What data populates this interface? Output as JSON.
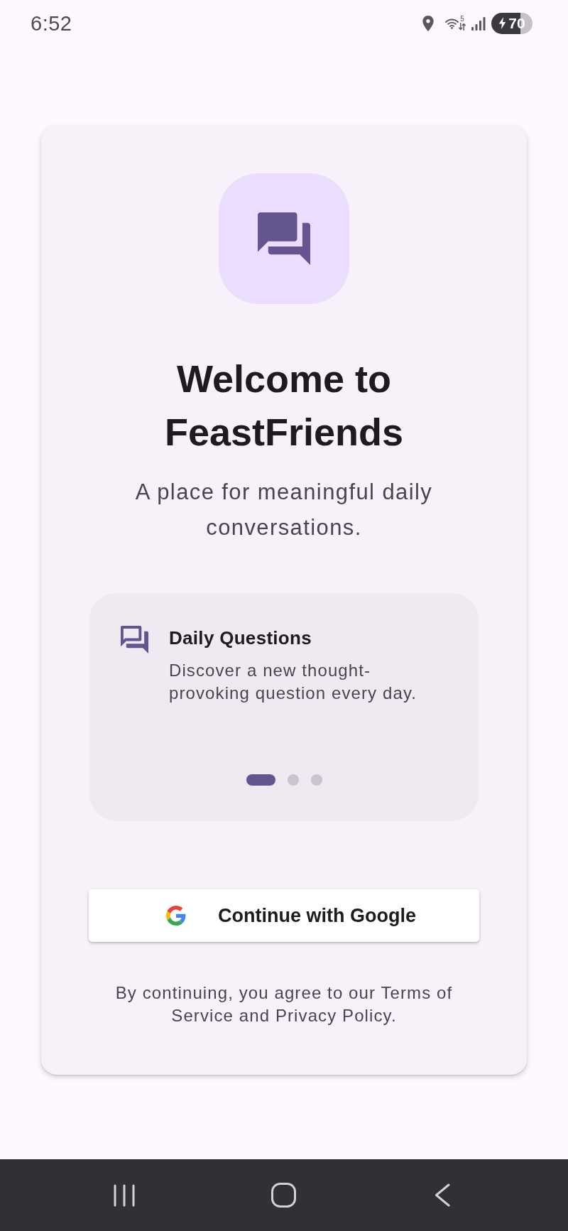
{
  "status_bar": {
    "time": "6:52",
    "wifi_band": "5",
    "battery": "70"
  },
  "welcome": {
    "title": "Welcome to FeastFriends",
    "subtitle": "A place for meaningful daily conversations.",
    "carousel": {
      "title": "Daily Questions",
      "description": "Discover a new thought-provoking question every day.",
      "page_dots": [
        {
          "selected": true
        },
        {
          "selected": false
        },
        {
          "selected": false
        }
      ]
    },
    "google_button": {
      "label": "Continue with Google"
    },
    "terms": "By continuing, you agree to our Terms of Service and Privacy Policy."
  }
}
